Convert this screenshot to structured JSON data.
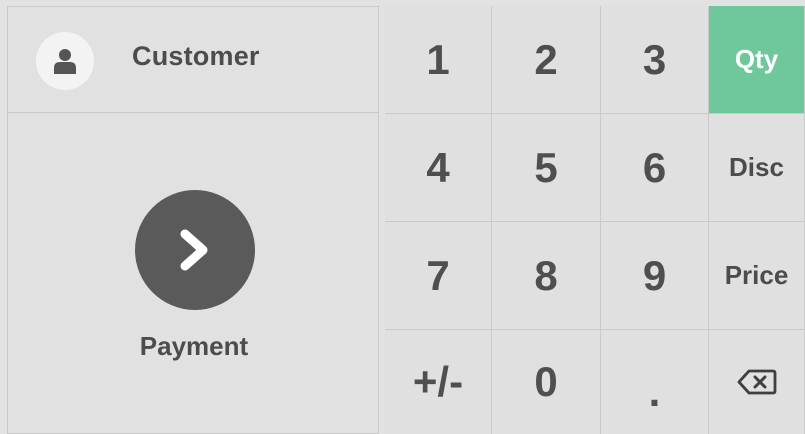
{
  "left_panel": {
    "customer": {
      "label": "Customer",
      "icon": "user-icon"
    },
    "payment": {
      "label": "Payment",
      "icon": "chevron-right-icon"
    }
  },
  "numpad": {
    "row1": [
      "1",
      "2",
      "3"
    ],
    "row2": [
      "4",
      "5",
      "6"
    ],
    "row3": [
      "7",
      "8",
      "9"
    ],
    "row4": [
      "+/-",
      "0",
      "."
    ],
    "modes": {
      "qty": "Qty",
      "disc": "Disc",
      "price": "Price"
    },
    "active_mode": "Qty",
    "backspace_icon": "backspace-icon"
  },
  "colors": {
    "active_mode_bg": "#6ec89b",
    "payment_circle": "#5a5a5a",
    "key_bg": "#e0e0e0"
  }
}
